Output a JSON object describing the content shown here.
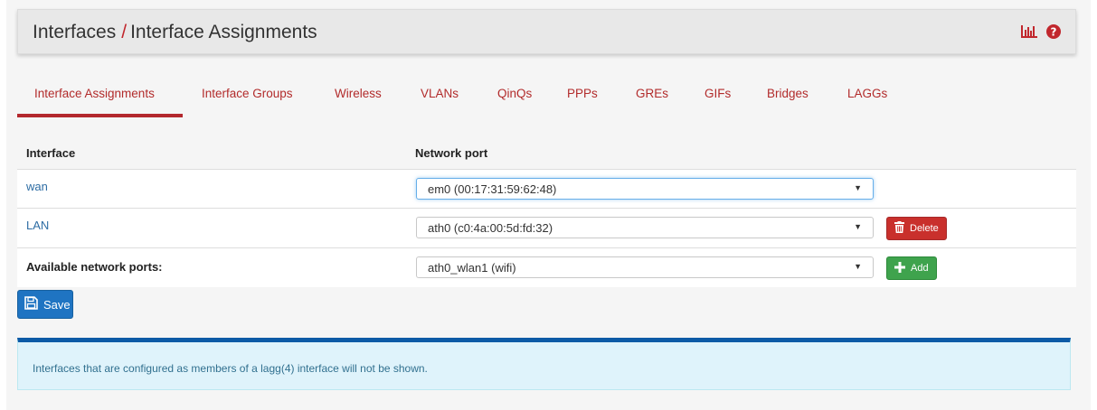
{
  "header": {
    "breadcrumb_parent": "Interfaces",
    "separator": "/",
    "breadcrumb_current": "Interface Assignments",
    "icons": [
      "bar-chart-icon",
      "help-icon"
    ]
  },
  "tabs": [
    {
      "label": "Interface Assignments",
      "active": true
    },
    {
      "label": "Interface Groups",
      "active": false
    },
    {
      "label": "Wireless",
      "active": false
    },
    {
      "label": "VLANs",
      "active": false
    },
    {
      "label": "QinQs",
      "active": false
    },
    {
      "label": "PPPs",
      "active": false
    },
    {
      "label": "GREs",
      "active": false
    },
    {
      "label": "GIFs",
      "active": false
    },
    {
      "label": "Bridges",
      "active": false
    },
    {
      "label": "LAGGs",
      "active": false
    }
  ],
  "table": {
    "col_interface": "Interface",
    "col_network_port": "Network port",
    "rows": [
      {
        "interface": "wan",
        "port": "em0 (00:17:31:59:62:48)"
      },
      {
        "interface": "LAN",
        "port": "ath0 (c0:4a:00:5d:fd:32)",
        "action": "Delete"
      }
    ],
    "available_label": "Available network ports:",
    "available_port": "ath0_wlan1 (wifi)",
    "add_label": "Add"
  },
  "save_label": "Save",
  "info_message": "Interfaces that are configured as members of a lagg(4) interface will not be shown.",
  "colors": {
    "accent_red": "#b3282d",
    "link_blue": "#2e6da4",
    "save_blue": "#1f74c2",
    "delete_red": "#c9302c",
    "add_green": "#3fa34d",
    "info_border": "#0c5aa6"
  }
}
